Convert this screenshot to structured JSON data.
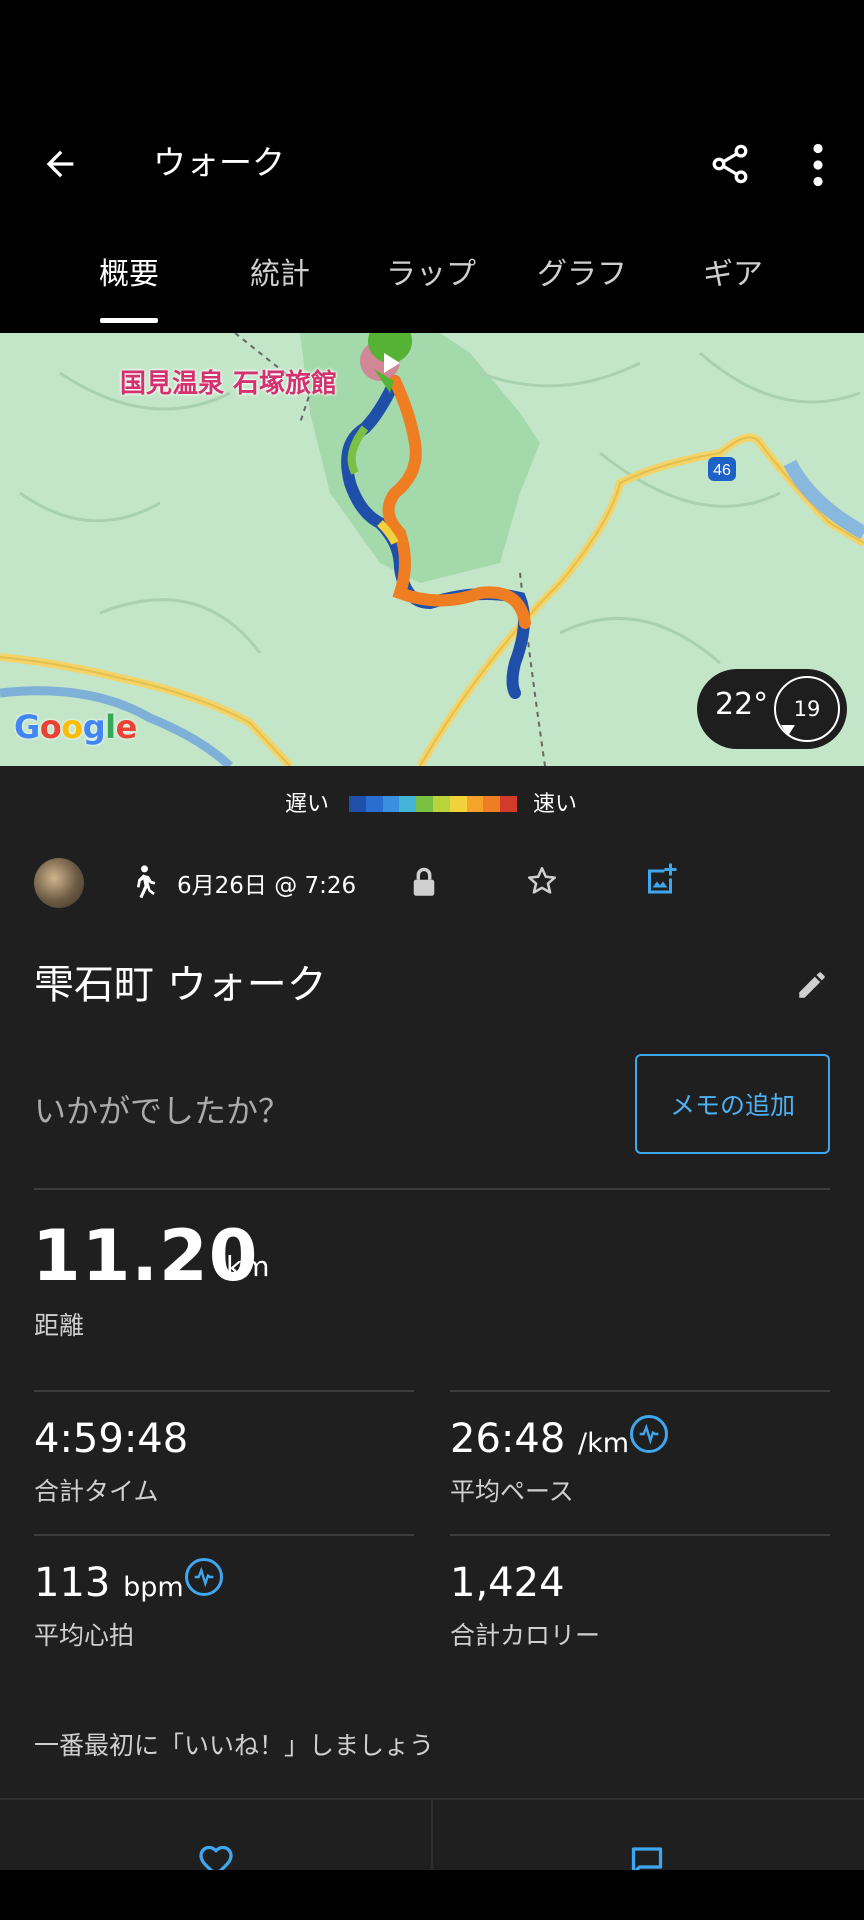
{
  "header": {
    "title": "ウォーク"
  },
  "tabs": [
    {
      "label": "概要",
      "active": true
    },
    {
      "label": "統計",
      "active": false
    },
    {
      "label": "ラップ",
      "active": false
    },
    {
      "label": "グラフ",
      "active": false
    },
    {
      "label": "ギア",
      "active": false
    }
  ],
  "map": {
    "poi_label": "国見温泉 石塚旅館",
    "road_number": "46",
    "attribution": "Google",
    "weather": {
      "temperature": "22°",
      "wind": "19"
    }
  },
  "legend": {
    "slow": "遅い",
    "fast": "速い",
    "colors": [
      "#1f4fa8",
      "#2a6fd0",
      "#3a8fe0",
      "#43b3d6",
      "#7ac143",
      "#b9d33a",
      "#f1d13c",
      "#f5a32a",
      "#ef7d22",
      "#d23a2a"
    ]
  },
  "activity": {
    "date": "6月26日 @ 7:26",
    "name": "雫石町 ウォーク",
    "prompt": "いかがでしたか？",
    "memo_button": "メモの追加"
  },
  "stats": {
    "distance": {
      "value": "11.20",
      "unit": "km",
      "label": "距離"
    },
    "total_time": {
      "value": "4:59:48",
      "label": "合計タイム"
    },
    "avg_pace": {
      "value": "26:48",
      "unit": "/km",
      "label": "平均ペース"
    },
    "avg_hr": {
      "value": "113",
      "unit": "bpm",
      "label": "平均心拍"
    },
    "calories": {
      "value": "1,424",
      "label": "合計カロリー"
    }
  },
  "social": {
    "like_prompt": "一番最初に「いいね！」しましょう"
  },
  "colors": {
    "accent": "#3ea7f0",
    "background": "#1f1f1f",
    "map_green": "#bde3c4"
  }
}
